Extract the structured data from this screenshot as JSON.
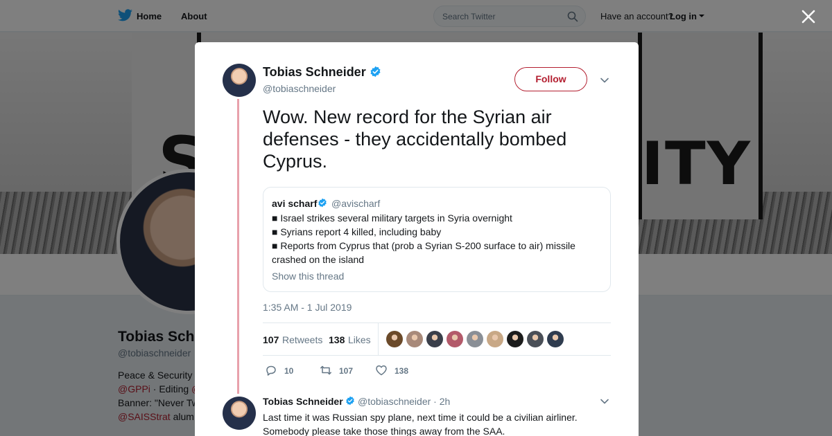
{
  "topbar": {
    "home_label": "Home",
    "about_label": "About",
    "search_placeholder": "Search Twitter",
    "have_account": "Have an account?",
    "login_label": "Log in"
  },
  "banner": {
    "left_text": "S",
    "right_text": "ITY"
  },
  "profile": {
    "name": "Tobias Sch",
    "handle": "@tobiaschneider",
    "bio": {
      "line1": "Peace & Security",
      "line2_link": "@GPPi",
      "line2_text": " · Editing ",
      "line2_link2": "@",
      "line3": "Banner: \"Never Tw",
      "line4_link": "@SAISStrat",
      "line4_text": " alum"
    }
  },
  "tweet": {
    "author_name": "Tobias Schneider",
    "author_handle": "@tobiaschneider",
    "follow_label": "Follow",
    "text": "Wow. New record for the Syrian air defenses - they accidentally bombed Cyprus.",
    "timestamp": "1:35 AM - 1 Jul 2019",
    "quote": {
      "name": "avi scharf",
      "handle": "@avischarf",
      "line1": "■ Israel strikes several military targets in Syria overnight",
      "line2": "■ Syrians report 4 killed, including baby",
      "line3": "■ Reports from Cyprus that (prob a Syrian S-200 surface to air) missile crashed on the island",
      "show_thread": "Show this thread"
    },
    "stats": {
      "retweets": "107",
      "retweets_label": "Retweets",
      "likes": "138",
      "likes_label": "Likes"
    },
    "liker_colors": [
      "#6b4a2a",
      "#a88a7a",
      "#3a3f4a",
      "#b35a6a",
      "#8a8f96",
      "#c8a886",
      "#1c1c1c",
      "#4a4f57",
      "#2f3c4f"
    ],
    "actions": {
      "replies": "10",
      "retweets": "107",
      "likes": "138"
    }
  },
  "reply": {
    "author_name": "Tobias Schneider",
    "author_handle": "@tobiaschneider",
    "age": "· 2h",
    "text": "Last time it was Russian spy plane, next time it could be a civilian airliner. Somebody please take those things away from the SAA."
  },
  "colors": {
    "accent": "#b31e2f",
    "verified": "#1da1f2",
    "thread_line": "#e8a1ab",
    "muted": "#657786"
  }
}
